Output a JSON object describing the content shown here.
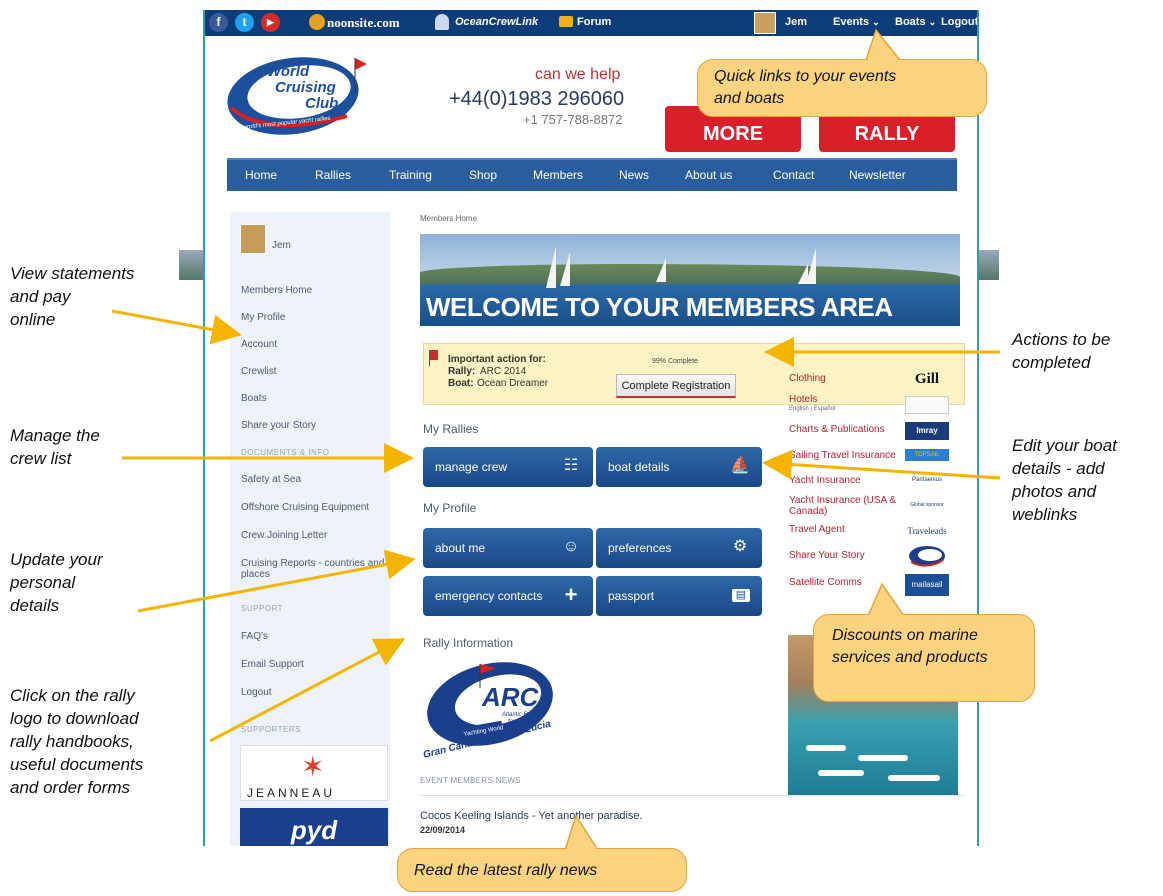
{
  "topbar": {
    "facebook": "f",
    "twitter": "t",
    "youtube": "▶",
    "noonsite": "noonsite.com",
    "oceancrew": "OceanCrewLink",
    "forum": "Forum",
    "user": "Jem",
    "events": "Events",
    "boats": "Boats",
    "logout": "Logout",
    "chevron": "⌄"
  },
  "header": {
    "logo_line1": "World",
    "logo_line2": "Cruising",
    "logo_line3": "Club",
    "logo_tagline": "the world's most popular yacht rallies",
    "help_label": "can we help",
    "phone_uk": "+44(0)1983 296060",
    "phone_us": "+1 757-788-8872",
    "btn_more": "MORE",
    "btn_rally": "RALLY"
  },
  "nav": [
    "Home",
    "Rallies",
    "Training",
    "Shop",
    "Members",
    "News",
    "About us",
    "Contact",
    "Newsletter"
  ],
  "sidebar": {
    "user": "Jem",
    "items": [
      "Members Home",
      "My Profile",
      "Account",
      "Crewlist",
      "Boats",
      "Share your Story"
    ],
    "docs_heading": "DOCUMENTS & INFO",
    "docs": [
      "Safety at Sea",
      "Offshore Cruising Equipment",
      "Crew Joining Letter",
      "Cruising Reports - countries and",
      "places"
    ],
    "support_heading": "SUPPORT",
    "support": [
      "FAQ's",
      "Email Support",
      "Logout"
    ],
    "supporters_heading": "SUPPORTERS",
    "jeanneau": "JEANNEAU",
    "pyd": "pyd"
  },
  "main": {
    "breadcrumb": "Members Home",
    "banner_title": "WELCOME TO YOUR MEMBERS AREA",
    "action": {
      "heading": "Important action for:",
      "rally_label": "Rally:",
      "rally_value": "ARC 2014",
      "boat_label": "Boat:",
      "boat_value": "Ocean Dreamer",
      "progress_text": "99% Complete",
      "progress": 0.99,
      "button": "Complete Registration"
    },
    "my_rallies": "My Rallies",
    "tiles_rallies": [
      {
        "label": "manage crew",
        "icon": "crew-icon"
      },
      {
        "label": "boat details",
        "icon": "sailboat-icon"
      }
    ],
    "my_profile": "My Profile",
    "tiles_profile": [
      {
        "label": "about me",
        "icon": "person-icon"
      },
      {
        "label": "preferences",
        "icon": "gear-icon"
      },
      {
        "label": "emergency contacts",
        "icon": "plus-icon"
      },
      {
        "label": "passport",
        "icon": "id-card-icon"
      }
    ],
    "rally_info": "Rally Information",
    "arc": {
      "title": "ARC",
      "subtitle1": "Atlantic Rally",
      "subtitle2": "for Cruisers",
      "sponsor": "Yachting World",
      "route": "Gran Canaria to Saint Lucia"
    },
    "news_heading": "EVENT MEMBERS NEWS",
    "news_title": "Cocos Keeling Islands - Yet another paradise.",
    "news_date": "22/09/2014"
  },
  "right": {
    "items": [
      {
        "label": "Clothing",
        "logo": "Gill"
      },
      {
        "label": "Hotels",
        "sub": "English | Español",
        "logo": ""
      },
      {
        "label": "Charts & Publications",
        "logo": "Imray"
      },
      {
        "label": "Sailing Travel Insurance",
        "logo": "TOPSAIL"
      },
      {
        "label": "Yacht Insurance",
        "logo": "Pantaenius"
      },
      {
        "label": "Yacht Insurance (USA &",
        "label2": "Canada)",
        "logo": "Global sponsor"
      },
      {
        "label": "Travel Agent",
        "logo": "Traveleads"
      },
      {
        "label": "Share Your Story",
        "logo": ""
      },
      {
        "label": "Satellite Comms",
        "logo": "mailasail"
      }
    ]
  },
  "annotations": {
    "statements": [
      "View statements",
      "and pay",
      "online"
    ],
    "crew": [
      "Manage the",
      "crew list"
    ],
    "personal": [
      "Update your",
      "personal",
      "details"
    ],
    "logo": [
      "Click on the rally",
      "logo to download",
      "rally handbooks,",
      "useful documents",
      "and order forms"
    ],
    "actions": [
      "Actions to be",
      "completed"
    ],
    "boat": [
      "Edit your boat",
      "details - add",
      "photos and",
      "weblinks"
    ],
    "quicklinks": [
      "Quick links to your events",
      "and boats"
    ],
    "discounts": [
      "Discounts on marine",
      "services and products"
    ],
    "news": "Read the latest rally news"
  },
  "colors": {
    "topbar": "#0d3d79",
    "nav": "#2a5d9c",
    "tile": "#1f5494",
    "callout": "#fcd480",
    "arrow": "#f5b400",
    "accent_red": "#d9202a"
  }
}
